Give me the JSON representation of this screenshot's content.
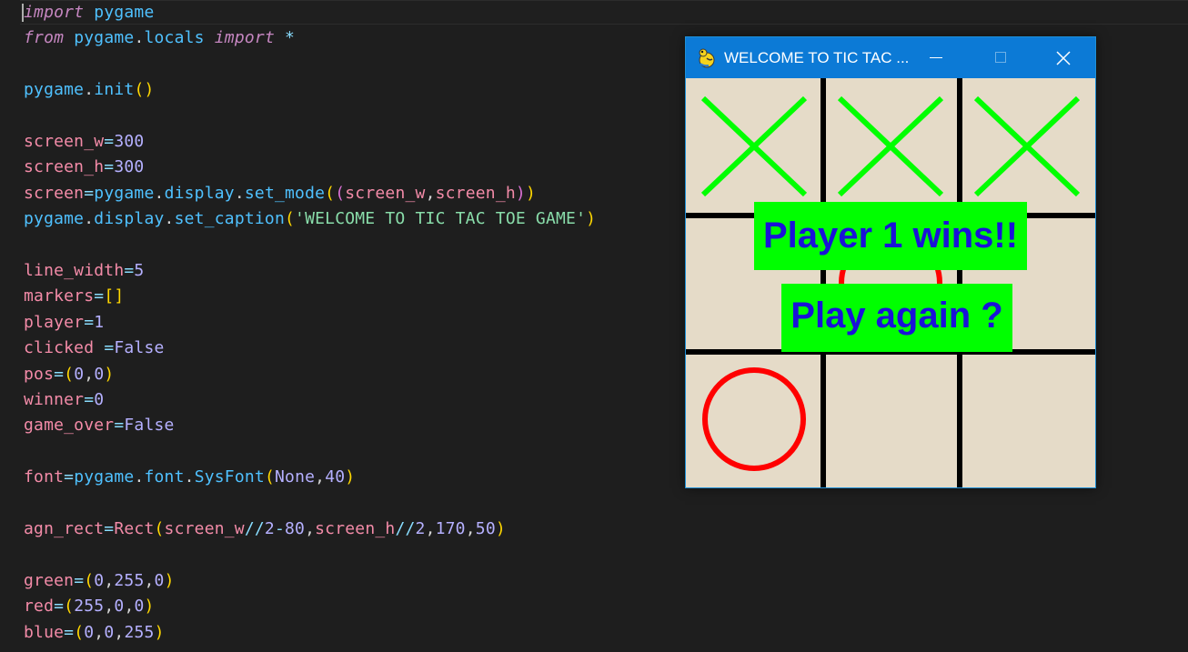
{
  "editor": {
    "lines": [
      [
        {
          "t": "import",
          "c": "kw"
        },
        {
          "t": " ",
          "c": "plain"
        },
        {
          "t": "pygame",
          "c": "mod"
        }
      ],
      [
        {
          "t": "from",
          "c": "kw"
        },
        {
          "t": " ",
          "c": "plain"
        },
        {
          "t": "pygame",
          "c": "mod"
        },
        {
          "t": ".",
          "c": "plain"
        },
        {
          "t": "locals",
          "c": "mod"
        },
        {
          "t": " ",
          "c": "plain"
        },
        {
          "t": "import",
          "c": "kw"
        },
        {
          "t": " ",
          "c": "plain"
        },
        {
          "t": "*",
          "c": "op"
        }
      ],
      [],
      [
        {
          "t": "pygame",
          "c": "mod"
        },
        {
          "t": ".",
          "c": "plain"
        },
        {
          "t": "init",
          "c": "fn"
        },
        {
          "t": "()",
          "c": "p1"
        }
      ],
      [],
      [
        {
          "t": "screen_w",
          "c": "var2"
        },
        {
          "t": "=",
          "c": "op"
        },
        {
          "t": "300",
          "c": "num"
        }
      ],
      [
        {
          "t": "screen_h",
          "c": "var2"
        },
        {
          "t": "=",
          "c": "op"
        },
        {
          "t": "300",
          "c": "num"
        }
      ],
      [
        {
          "t": "screen",
          "c": "var2"
        },
        {
          "t": "=",
          "c": "op"
        },
        {
          "t": "pygame",
          "c": "mod"
        },
        {
          "t": ".",
          "c": "plain"
        },
        {
          "t": "display",
          "c": "attr"
        },
        {
          "t": ".",
          "c": "plain"
        },
        {
          "t": "set_mode",
          "c": "fn"
        },
        {
          "t": "(",
          "c": "p1"
        },
        {
          "t": "(",
          "c": "p2"
        },
        {
          "t": "screen_w",
          "c": "var2"
        },
        {
          "t": ",",
          "c": "plain"
        },
        {
          "t": "screen_h",
          "c": "var2"
        },
        {
          "t": ")",
          "c": "p2"
        },
        {
          "t": ")",
          "c": "p1"
        }
      ],
      [
        {
          "t": "pygame",
          "c": "mod"
        },
        {
          "t": ".",
          "c": "plain"
        },
        {
          "t": "display",
          "c": "attr"
        },
        {
          "t": ".",
          "c": "plain"
        },
        {
          "t": "set_caption",
          "c": "fn"
        },
        {
          "t": "(",
          "c": "p1"
        },
        {
          "t": "'WELCOME TO TIC TAC TOE GAME'",
          "c": "str"
        },
        {
          "t": ")",
          "c": "p1"
        }
      ],
      [],
      [
        {
          "t": "line_width",
          "c": "var2"
        },
        {
          "t": "=",
          "c": "op"
        },
        {
          "t": "5",
          "c": "num"
        }
      ],
      [
        {
          "t": "markers",
          "c": "var2"
        },
        {
          "t": "=",
          "c": "op"
        },
        {
          "t": "[]",
          "c": "p1"
        }
      ],
      [
        {
          "t": "player",
          "c": "var2"
        },
        {
          "t": "=",
          "c": "op"
        },
        {
          "t": "1",
          "c": "num"
        }
      ],
      [
        {
          "t": "clicked",
          "c": "var2"
        },
        {
          "t": " ",
          "c": "plain"
        },
        {
          "t": "=",
          "c": "op"
        },
        {
          "t": "False",
          "c": "const"
        }
      ],
      [
        {
          "t": "pos",
          "c": "var2"
        },
        {
          "t": "=",
          "c": "op"
        },
        {
          "t": "(",
          "c": "p1"
        },
        {
          "t": "0",
          "c": "num"
        },
        {
          "t": ",",
          "c": "plain"
        },
        {
          "t": "0",
          "c": "num"
        },
        {
          "t": ")",
          "c": "p1"
        }
      ],
      [
        {
          "t": "winner",
          "c": "var2"
        },
        {
          "t": "=",
          "c": "op"
        },
        {
          "t": "0",
          "c": "num"
        }
      ],
      [
        {
          "t": "game_over",
          "c": "var2"
        },
        {
          "t": "=",
          "c": "op"
        },
        {
          "t": "False",
          "c": "const"
        }
      ],
      [],
      [
        {
          "t": "font",
          "c": "var2"
        },
        {
          "t": "=",
          "c": "op"
        },
        {
          "t": "pygame",
          "c": "mod"
        },
        {
          "t": ".",
          "c": "plain"
        },
        {
          "t": "font",
          "c": "attr"
        },
        {
          "t": ".",
          "c": "plain"
        },
        {
          "t": "SysFont",
          "c": "fn"
        },
        {
          "t": "(",
          "c": "p1"
        },
        {
          "t": "None",
          "c": "const"
        },
        {
          "t": ",",
          "c": "plain"
        },
        {
          "t": "40",
          "c": "num"
        },
        {
          "t": ")",
          "c": "p1"
        }
      ],
      [],
      [
        {
          "t": "agn_rect",
          "c": "var2"
        },
        {
          "t": "=",
          "c": "op"
        },
        {
          "t": "Rect",
          "c": "cls"
        },
        {
          "t": "(",
          "c": "p1"
        },
        {
          "t": "screen_w",
          "c": "var2"
        },
        {
          "t": "//",
          "c": "op"
        },
        {
          "t": "2",
          "c": "num"
        },
        {
          "t": "-",
          "c": "op"
        },
        {
          "t": "80",
          "c": "num"
        },
        {
          "t": ",",
          "c": "plain"
        },
        {
          "t": "screen_h",
          "c": "var2"
        },
        {
          "t": "//",
          "c": "op"
        },
        {
          "t": "2",
          "c": "num"
        },
        {
          "t": ",",
          "c": "plain"
        },
        {
          "t": "170",
          "c": "num"
        },
        {
          "t": ",",
          "c": "plain"
        },
        {
          "t": "50",
          "c": "num"
        },
        {
          "t": ")",
          "c": "p1"
        }
      ],
      [],
      [
        {
          "t": "green",
          "c": "var2"
        },
        {
          "t": "=",
          "c": "op"
        },
        {
          "t": "(",
          "c": "p1"
        },
        {
          "t": "0",
          "c": "num"
        },
        {
          "t": ",",
          "c": "plain"
        },
        {
          "t": "255",
          "c": "num"
        },
        {
          "t": ",",
          "c": "plain"
        },
        {
          "t": "0",
          "c": "num"
        },
        {
          "t": ")",
          "c": "p1"
        }
      ],
      [
        {
          "t": "red",
          "c": "var2"
        },
        {
          "t": "=",
          "c": "op"
        },
        {
          "t": "(",
          "c": "p1"
        },
        {
          "t": "255",
          "c": "num"
        },
        {
          "t": ",",
          "c": "plain"
        },
        {
          "t": "0",
          "c": "num"
        },
        {
          "t": ",",
          "c": "plain"
        },
        {
          "t": "0",
          "c": "num"
        },
        {
          "t": ")",
          "c": "p1"
        }
      ],
      [
        {
          "t": "blue",
          "c": "var2"
        },
        {
          "t": "=",
          "c": "op"
        },
        {
          "t": "(",
          "c": "p1"
        },
        {
          "t": "0",
          "c": "num"
        },
        {
          "t": ",",
          "c": "plain"
        },
        {
          "t": "0",
          "c": "num"
        },
        {
          "t": ",",
          "c": "plain"
        },
        {
          "t": "255",
          "c": "num"
        },
        {
          "t": ")",
          "c": "p1"
        }
      ]
    ]
  },
  "game_window": {
    "title": "WELCOME TO TIC TAC ...",
    "app_icon": "pygame-snake-icon",
    "controls": {
      "minimize_icon": "minimize-icon",
      "maximize_icon": "maximize-icon",
      "close_icon": "close-icon"
    },
    "board": {
      "cells": [
        [
          "X",
          "X",
          "X"
        ],
        [
          "",
          "O",
          ""
        ],
        [
          "O",
          "",
          ""
        ]
      ],
      "x_color": "#00ff00",
      "o_color": "#ff0000",
      "background_color": "#e5dbc8",
      "grid_color": "#000000"
    },
    "winner_message": "Player 1 wins!!",
    "play_again_label": "Play again ?",
    "overlay_color": "#00ff00",
    "overlay_text_color": "#1a12d8"
  }
}
